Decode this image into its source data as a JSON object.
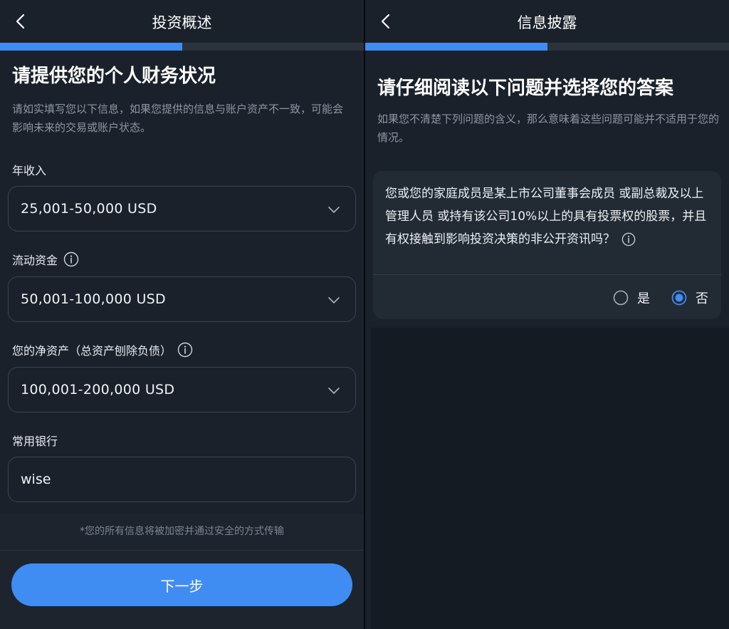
{
  "left_screen": {
    "nav_title": "投资概述",
    "progress": 0.5,
    "heading": "请提供您的个人财务状况",
    "subtitle": "请如实填写您以下信息，如果您提供的信息与账户资产不一致，可能会影响未来的交易或账户状态。",
    "fields": {
      "annual_income": {
        "label": "年收入",
        "value": "25,001-50,000 USD"
      },
      "liquid_assets": {
        "label": "流动资金",
        "value": "50,001-100,000 USD"
      },
      "net_worth": {
        "label": "您的净资产（总资产刨除负债）",
        "value": "100,001-200,000 USD"
      },
      "bank": {
        "label": "常用银行",
        "value": "wise"
      }
    },
    "secure_note": "*您的所有信息将被加密并通过安全的方式传输",
    "next_button": "下一步"
  },
  "right_screen": {
    "nav_title": "信息披露",
    "progress": 0.5,
    "heading": "请仔细阅读以下问题并选择您的答案",
    "subtitle": "如果您不清楚下列问题的含义，那么意味着这些问题可能并不适用于您的情况。",
    "question": "您或您的家庭成员是某上市公司董事会成员 或副总裁及以上管理人员 或持有该公司10%以上的具有投票权的股票，并且有权接触到影响投资决策的非公开资讯吗？",
    "options": [
      {
        "label": "是",
        "selected": false
      },
      {
        "label": "否",
        "selected": true
      }
    ]
  },
  "colors": {
    "accent": "#3f8cf3",
    "background": "#1a212b",
    "muted_text": "#8d96a3"
  },
  "icons": [
    "back-arrow-icon",
    "info-icon",
    "chevron-down-icon",
    "radio-unselected-icon",
    "radio-selected-icon"
  ]
}
